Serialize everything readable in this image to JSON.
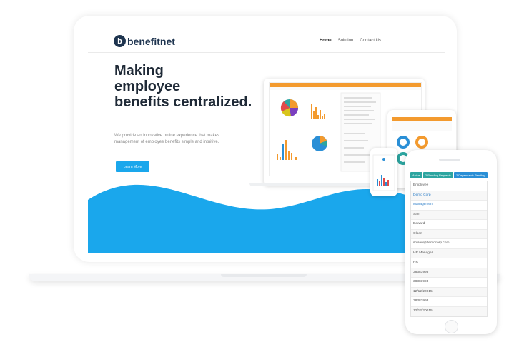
{
  "brand": {
    "logo_mark": "b",
    "name": "benefitnet"
  },
  "nav": {
    "items": [
      {
        "label": "Home",
        "active": true
      },
      {
        "label": "Solution",
        "active": false
      },
      {
        "label": "Contact Us",
        "active": false
      }
    ]
  },
  "hero": {
    "title_lines": [
      "Making",
      "employee",
      "benefits centralized."
    ],
    "description": "We provide an innovative online experience that makes management of employee benefits simple and intuitive.",
    "cta_label": "Learn More"
  },
  "phone_app": {
    "tabs": [
      {
        "label": "Active",
        "color": "#2ca5a0"
      },
      {
        "label": "2 Pending Requests",
        "color": "#2ca5a0"
      },
      {
        "label": "2 Dependants Pending",
        "color": "#2a8fd6"
      }
    ],
    "rows": [
      "Employee",
      "Demo Corp",
      "Management",
      "Sam",
      "Edward",
      "Olsen",
      "solsen@democorp.com",
      "HR Manager",
      "HR",
      "38383993",
      "38383993",
      "12/12/20015",
      "38383993",
      "12/12/20015"
    ]
  },
  "colors": {
    "accent": "#1aa7ec",
    "navy": "#1f3550",
    "teal": "#2ca5a0",
    "orange": "#f39a2e"
  }
}
